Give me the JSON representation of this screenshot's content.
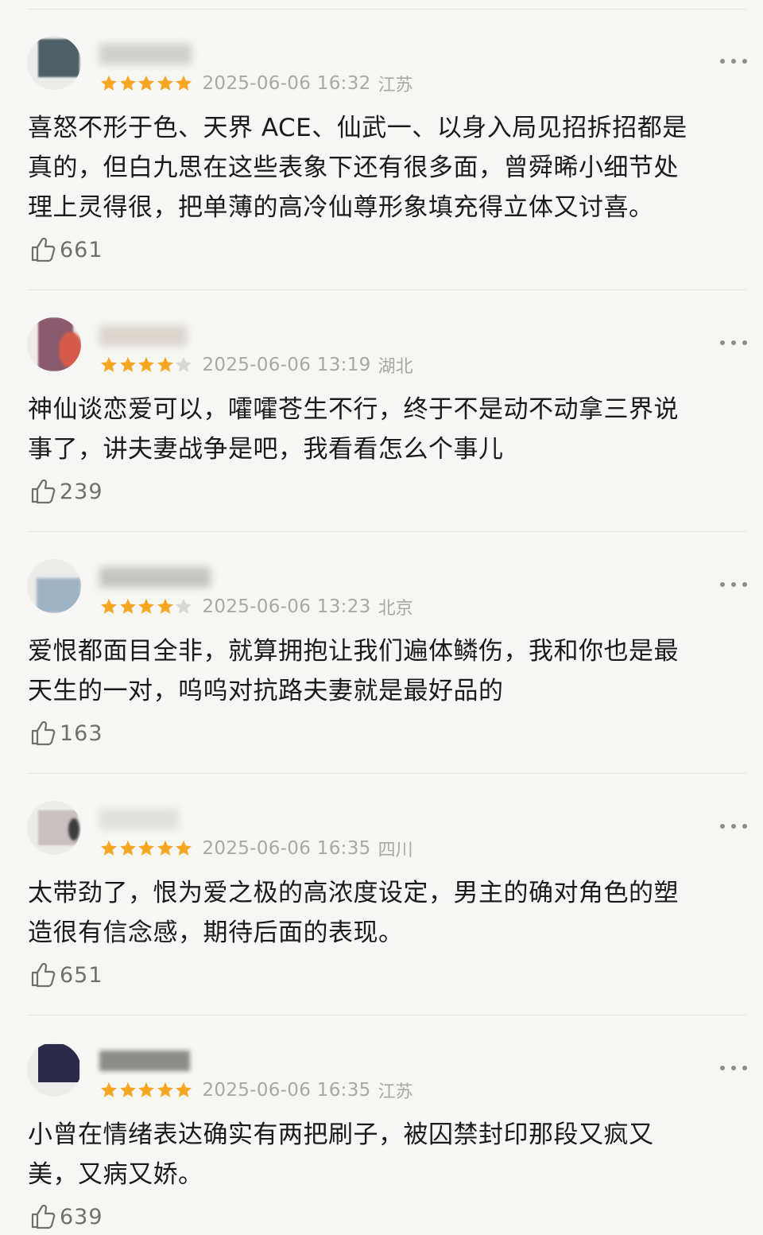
{
  "comments": [
    {
      "rating": 5,
      "date": "2025-06-06 16:32",
      "location": "江苏",
      "text_lines": [
        "喜怒不形于色、天界 ACE、仙武一、以身入局见招拆招都是",
        "真的，但白九思在这些表象下还有很多面，曾舜晞小细节处",
        "理上灵得很，把单薄的高冷仙尊形象填充得立体又讨喜。"
      ],
      "likes": "661",
      "avatar_color": "#4f5f66",
      "username_color": "#c9c9c6"
    },
    {
      "rating": 4,
      "date": "2025-06-06 13:19",
      "location": "湖北",
      "text_lines": [
        "神仙谈恋爱可以，嚯嚯苍生不行，终于不是动不动拿三界说",
        "事了，讲夫妻战争是吧，我看看怎么个事儿"
      ],
      "likes": "239",
      "avatar_color": "#8a5a6e",
      "username_color": "#d8cfc6"
    },
    {
      "rating": 4,
      "date": "2025-06-06 13:23",
      "location": "北京",
      "text_lines": [
        "爱恨都面目全非，就算拥抱让我们遍体鳞伤，我和你也是最",
        "天生的一对，呜呜对抗路夫妻就是最好品的"
      ],
      "likes": "163",
      "avatar_color": "#9fb3c4",
      "username_color": "#bcbcba"
    },
    {
      "rating": 5,
      "date": "2025-06-06 16:35",
      "location": "四川",
      "text_lines": [
        "太带劲了，恨为爱之极的高浓度设定，男主的确对角色的塑",
        "造很有信念感，期待后面的表现。"
      ],
      "likes": "651",
      "avatar_color": "#c9c1c0",
      "username_color": "#dcdcda"
    },
    {
      "rating": 5,
      "date": "2025-06-06 16:35",
      "location": "江苏",
      "text_lines": [
        "小曾在情绪表达确实有两把刷子，被囚禁封印那段又疯又",
        "美，又病又娇。"
      ],
      "likes": "639",
      "avatar_color": "#2b2a4a",
      "username_color": "#7a7a78"
    }
  ],
  "colors": {
    "star_filled": "#f5a623",
    "star_empty": "#d8d8d6",
    "text": "#1b1b1b",
    "meta": "#a8a8a6",
    "background": "#f6f6f4"
  },
  "icons": {
    "like": "thumbs-up-icon",
    "more": "more-dots-icon",
    "star": "star-icon"
  }
}
